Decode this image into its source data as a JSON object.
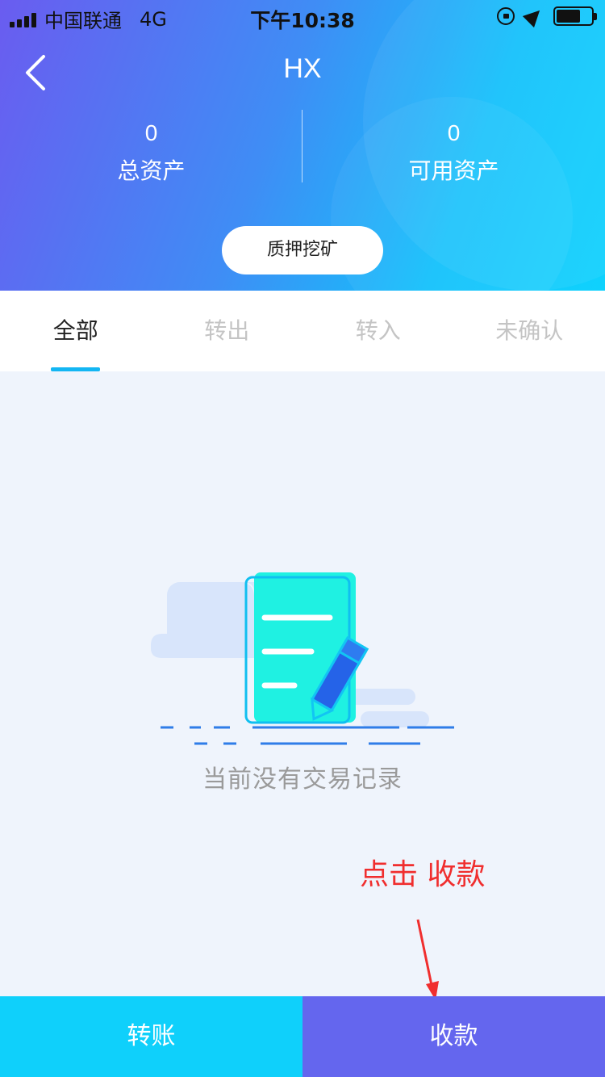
{
  "status_bar": {
    "carrier": "中国联通",
    "network": "4G",
    "time": "下午10:38"
  },
  "nav": {
    "title": "HX"
  },
  "assets": {
    "total": {
      "value": "0",
      "label": "总资产"
    },
    "available": {
      "value": "0",
      "label": "可用资产"
    }
  },
  "stake_button": "质押挖矿",
  "tabs": [
    "全部",
    "转出",
    "转入",
    "未确认"
  ],
  "empty_state": {
    "message": "当前没有交易记录"
  },
  "annotation": "点击 收款",
  "bottom_bar": {
    "transfer": "转账",
    "receive": "收款"
  },
  "colors": {
    "header_gradient_start": "#6a5cf0",
    "header_gradient_end": "#0fd2fd",
    "tab_indicator": "#13b6f3",
    "transfer_button": "#0fd0fb",
    "receive_button": "#6466ee",
    "annotation": "#f02e2e"
  }
}
